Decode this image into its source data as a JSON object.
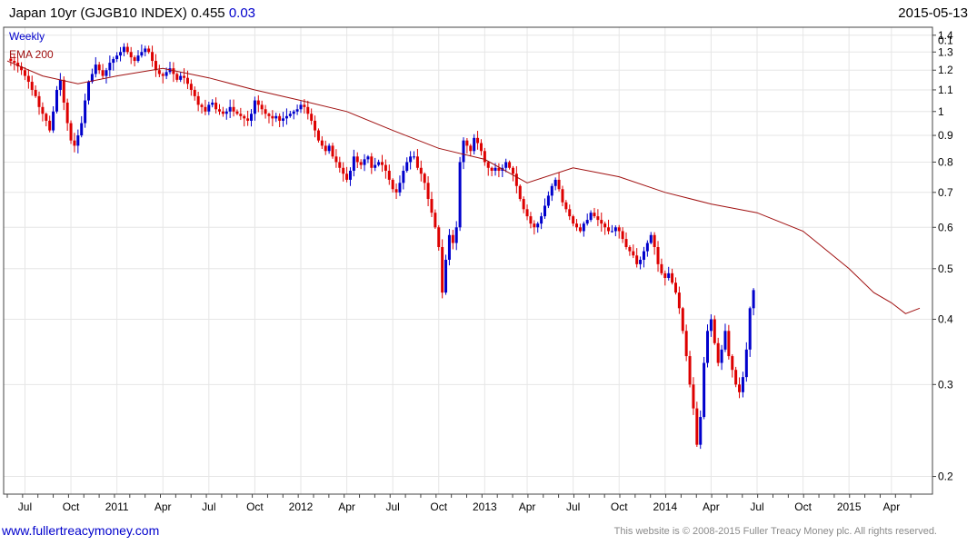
{
  "header": {
    "title": "Japan 10yr (GJGB10 INDEX)",
    "last": "0.455",
    "change": "0.03",
    "date": "2015-05-13"
  },
  "footer": {
    "site": "www.fullertreacymoney.com",
    "copyright": "This website is © 2008-2015 Fuller Treacy Money plc. All rights reserved."
  },
  "colors": {
    "up": "#0000cc",
    "down": "#dd0000",
    "ema": "#a01010",
    "grid": "#e6e6e6"
  },
  "chart_data": {
    "type": "candlestick",
    "title": "Japan 10yr (GJGB10 INDEX)",
    "period_label": "Weekly",
    "y_scale": "log",
    "ylim": [
      0.185,
      1.45
    ],
    "y_ticks": [
      0.2,
      0.3,
      0.4,
      0.5,
      0.6,
      0.7,
      0.8,
      0.9,
      1,
      1.1,
      1.2,
      1.3,
      1.4
    ],
    "y_tick_labels": [
      "0.2",
      "0.3",
      "0.4",
      "0.5",
      "0.6",
      "0.7",
      "0.8",
      "0.9",
      "1",
      "1.1",
      "1.2",
      "1.3",
      "1.4"
    ],
    "last_marker": "0.1",
    "x_labels": [
      "Jul",
      "Oct",
      "2011",
      "Apr",
      "Jul",
      "Oct",
      "2012",
      "Apr",
      "Jul",
      "Oct",
      "2013",
      "Apr",
      "Jul",
      "Oct",
      "2014",
      "Apr",
      "Jul",
      "Oct",
      "2015",
      "Apr"
    ],
    "x_label_weeks": [
      5,
      18,
      31,
      44,
      57,
      70,
      83,
      96,
      109,
      122,
      135,
      147,
      160,
      173,
      186,
      199,
      212,
      225,
      238,
      250
    ],
    "x_range_weeks": [
      0,
      258
    ],
    "close_weekly": [
      1.25,
      1.24,
      1.22,
      1.2,
      1.17,
      1.14,
      1.1,
      1.07,
      1.02,
      0.99,
      0.96,
      0.92,
      1.0,
      1.1,
      1.15,
      1.04,
      0.95,
      0.88,
      0.86,
      0.9,
      0.95,
      1.05,
      1.14,
      1.18,
      1.23,
      1.2,
      1.17,
      1.2,
      1.24,
      1.26,
      1.28,
      1.3,
      1.33,
      1.3,
      1.27,
      1.25,
      1.28,
      1.3,
      1.32,
      1.3,
      1.25,
      1.2,
      1.18,
      1.17,
      1.19,
      1.21,
      1.18,
      1.15,
      1.17,
      1.16,
      1.13,
      1.1,
      1.07,
      1.03,
      1.02,
      1.0,
      1.03,
      1.04,
      1.01,
      1.0,
      0.99,
      1.0,
      1.02,
      1.0,
      0.99,
      0.98,
      0.97,
      0.96,
      0.99,
      1.05,
      1.03,
      1.01,
      0.99,
      0.98,
      0.97,
      0.98,
      0.96,
      0.97,
      0.98,
      0.99,
      1.0,
      1.01,
      1.03,
      1.02,
      0.99,
      0.96,
      0.92,
      0.88,
      0.86,
      0.84,
      0.86,
      0.82,
      0.8,
      0.78,
      0.76,
      0.74,
      0.77,
      0.82,
      0.8,
      0.79,
      0.81,
      0.82,
      0.78,
      0.79,
      0.8,
      0.79,
      0.77,
      0.74,
      0.71,
      0.7,
      0.73,
      0.77,
      0.8,
      0.82,
      0.82,
      0.78,
      0.76,
      0.73,
      0.68,
      0.64,
      0.6,
      0.55,
      0.45,
      0.52,
      0.58,
      0.56,
      0.6,
      0.8,
      0.88,
      0.86,
      0.84,
      0.89,
      0.87,
      0.84,
      0.8,
      0.78,
      0.77,
      0.78,
      0.77,
      0.78,
      0.8,
      0.78,
      0.76,
      0.72,
      0.68,
      0.65,
      0.63,
      0.61,
      0.6,
      0.61,
      0.63,
      0.66,
      0.69,
      0.72,
      0.74,
      0.71,
      0.67,
      0.65,
      0.63,
      0.61,
      0.6,
      0.59,
      0.61,
      0.62,
      0.64,
      0.63,
      0.62,
      0.61,
      0.6,
      0.59,
      0.59,
      0.6,
      0.59,
      0.57,
      0.55,
      0.54,
      0.53,
      0.51,
      0.52,
      0.54,
      0.56,
      0.58,
      0.55,
      0.51,
      0.49,
      0.48,
      0.49,
      0.47,
      0.45,
      0.42,
      0.38,
      0.34,
      0.3,
      0.27,
      0.23,
      0.26,
      0.33,
      0.38,
      0.4,
      0.36,
      0.33,
      0.35,
      0.38,
      0.34,
      0.32,
      0.3,
      0.29,
      0.31,
      0.35,
      0.42,
      0.455
    ],
    "series": [
      {
        "name": "EMA 200",
        "values_at_weeks": [
          [
            0,
            1.25
          ],
          [
            10,
            1.17
          ],
          [
            20,
            1.13
          ],
          [
            31,
            1.17
          ],
          [
            44,
            1.21
          ],
          [
            57,
            1.16
          ],
          [
            70,
            1.1
          ],
          [
            83,
            1.05
          ],
          [
            96,
            1.0
          ],
          [
            109,
            0.92
          ],
          [
            122,
            0.85
          ],
          [
            135,
            0.81
          ],
          [
            147,
            0.73
          ],
          [
            160,
            0.78
          ],
          [
            173,
            0.75
          ],
          [
            186,
            0.7
          ],
          [
            199,
            0.665
          ],
          [
            212,
            0.64
          ],
          [
            225,
            0.59
          ],
          [
            238,
            0.5
          ],
          [
            245,
            0.45
          ],
          [
            250,
            0.43
          ],
          [
            254,
            0.41
          ],
          [
            258,
            0.42
          ]
        ]
      }
    ]
  }
}
